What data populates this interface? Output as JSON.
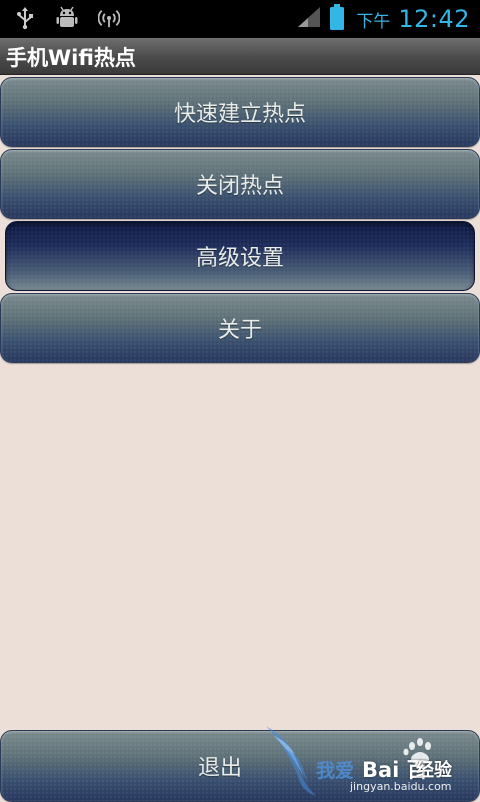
{
  "status_bar": {
    "icons": [
      "usb-icon",
      "android-debug-icon",
      "wifi-hotspot-icon",
      "signal-icon",
      "battery-icon"
    ],
    "ampm": "下午",
    "time": "12:42",
    "accent_color": "#33b5e5"
  },
  "title_bar": {
    "title": "手机Wifi热点"
  },
  "menu": {
    "items": [
      {
        "label": "快速建立热点"
      },
      {
        "label": "关闭热点"
      },
      {
        "label": "高级设置",
        "selected": true
      },
      {
        "label": "关于"
      }
    ],
    "exit_label": "退出"
  },
  "watermark": {
    "cn_text": "我爱",
    "brand": "Bai 百",
    "jingyan": "经验",
    "url": "jingyan.baidu.com"
  },
  "colors": {
    "background": "#ebdfd8",
    "button_top": "#7a8a8d",
    "button_bottom": "#27375e",
    "selected_top": "#0e1a44"
  }
}
